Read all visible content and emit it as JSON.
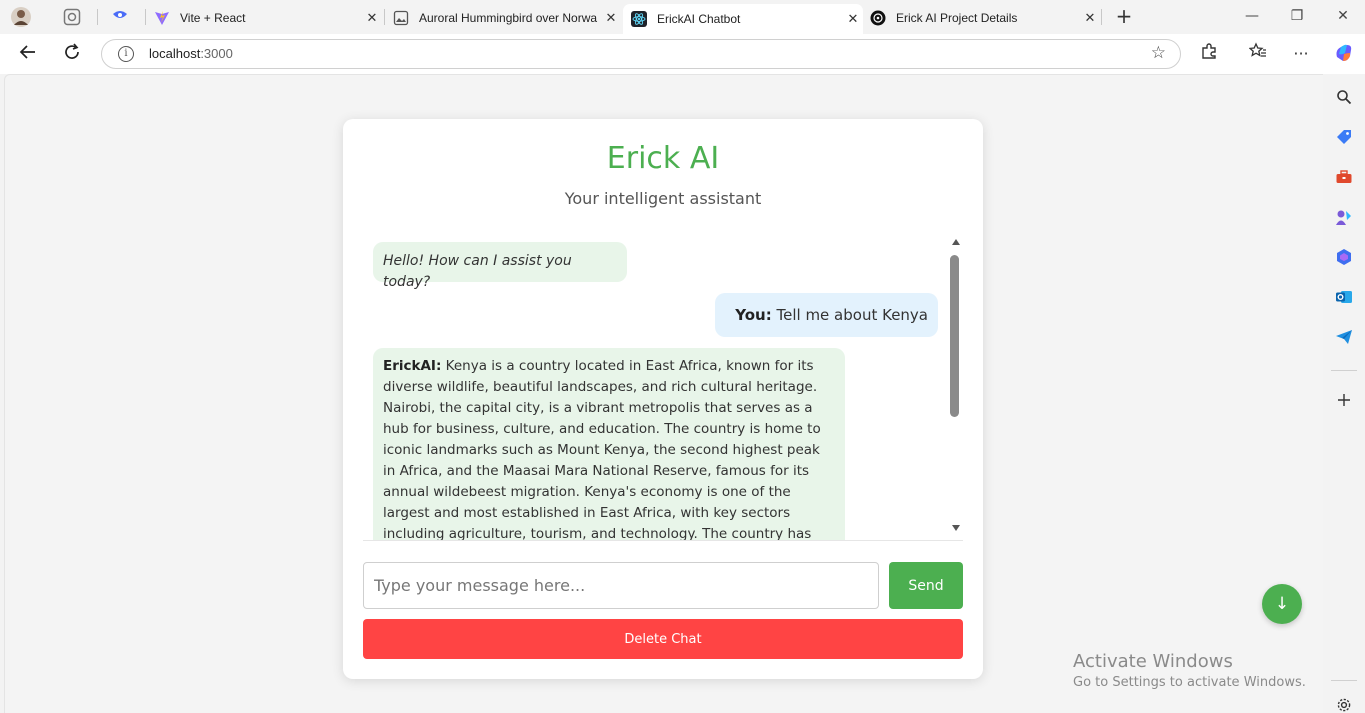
{
  "browser": {
    "tabs": [
      {
        "title": "Vite + React",
        "close": "✕"
      },
      {
        "title": "Auroral Hummingbird over Norwa",
        "close": "✕"
      },
      {
        "title": "ErickAI Chatbot",
        "close": "✕"
      },
      {
        "title": "Erick AI Project Details",
        "close": "✕"
      }
    ],
    "new_tab": "+",
    "url_host": "localhost",
    "url_port": ":3000",
    "window_controls": {
      "minimize": "—",
      "restore": "❐",
      "close": "✕"
    }
  },
  "page": {
    "title": "Erick AI",
    "subtitle": "Your intelligent assistant",
    "messages": [
      {
        "role": "bot",
        "text": "Hello! How can I assist you today?"
      },
      {
        "role": "user",
        "sender": "You:",
        "text": "Tell me about Kenya"
      },
      {
        "role": "bot",
        "sender": "ErickAI:",
        "text": "Kenya is a country located in East Africa, known for its diverse wildlife, beautiful landscapes, and rich cultural heritage. Nairobi, the capital city, is a vibrant metropolis that serves as a hub for business, culture, and education. The country is home to iconic landmarks such as Mount Kenya, the second highest peak in Africa, and the Maasai Mara National Reserve, famous for its annual wildebeest migration. Kenya's economy is one of the largest and most established in East Africa, with key sectors including agriculture, tourism, and technology. The country has"
      }
    ],
    "input_placeholder": "Type your message here...",
    "send_label": "Send",
    "delete_label": "Delete Chat",
    "scroll_down_arrow": "↓"
  },
  "watermark": {
    "line1": "Activate Windows",
    "line2": "Go to Settings to activate Windows."
  },
  "colors": {
    "accent_green": "#4caf50",
    "delete_red": "#ff4444",
    "bot_bubble": "#e8f5e9",
    "user_bubble": "#e3f2fd"
  }
}
